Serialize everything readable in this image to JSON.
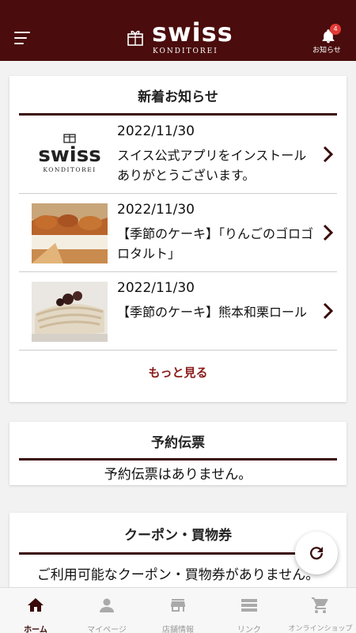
{
  "header": {
    "logo_word": "swiss",
    "logo_sub": "KONDITOREI",
    "notification_count": "4",
    "notification_label": "お知らせ"
  },
  "news": {
    "title": "新着お知らせ",
    "items": [
      {
        "date": "2022/11/30",
        "text": "スイス公式アプリをインストールありがとうございます。",
        "thumb_icon": "swiss-logo"
      },
      {
        "date": "2022/11/30",
        "text": "【季節のケーキ】「りんごのゴロゴロタルト」",
        "thumb_icon": "apple-tart-photo"
      },
      {
        "date": "2022/11/30",
        "text": "【季節のケーキ】熊本和栗ロール",
        "thumb_icon": "chestnut-roll-photo"
      }
    ],
    "more_label": "もっと見る"
  },
  "reservation": {
    "title": "予約伝票",
    "empty_text": "予約伝票はありません。"
  },
  "coupon": {
    "title": "クーポン・買物券",
    "empty_text": "ご利用可能なクーポン・買物券がありません。"
  },
  "tabs": [
    {
      "label": "ホーム",
      "icon": "home-icon",
      "active": true
    },
    {
      "label": "マイページ",
      "icon": "person-icon",
      "active": false
    },
    {
      "label": "店舗情報",
      "icon": "store-icon",
      "active": false
    },
    {
      "label": "リンク",
      "icon": "list-icon",
      "active": false
    },
    {
      "label": "オンラインショップ",
      "icon": "cart-icon",
      "active": false
    }
  ],
  "colors": {
    "brand": "#4a0c0c",
    "accent_link": "#8b1a1a",
    "badge": "#e53935"
  }
}
